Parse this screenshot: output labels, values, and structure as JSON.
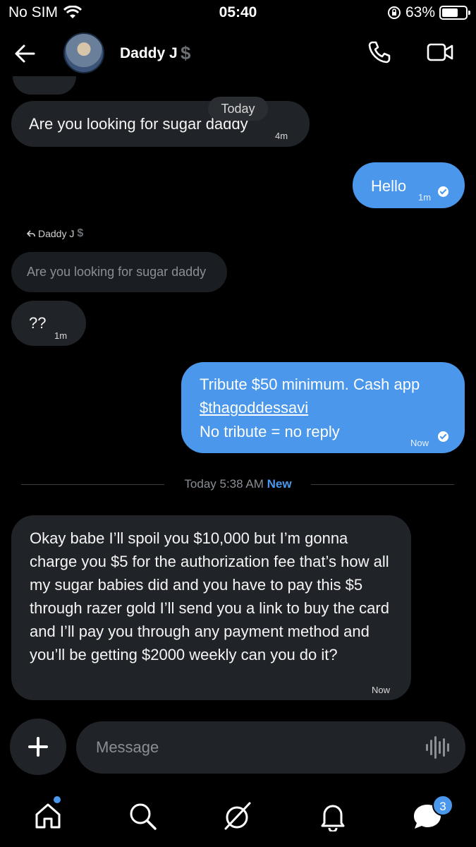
{
  "status_bar": {
    "carrier": "No SIM",
    "time": "05:40",
    "battery": "63%",
    "battery_level": 0.63
  },
  "header": {
    "contact_name": "Daddy J",
    "badge_symbol": "$",
    "back_icon": "back-arrow-icon",
    "call_icon": "phone-icon",
    "video_icon": "video-camera-icon"
  },
  "chat": {
    "date_pill": "Today",
    "messages": [
      {
        "direction": "incoming",
        "text": "Are you looking for sugar daddy",
        "time": "4m"
      },
      {
        "direction": "outgoing",
        "text": "Hello",
        "time": "1m",
        "read": true
      },
      {
        "direction": "incoming",
        "reply_to": "Daddy J",
        "reply_to_badge": "$",
        "quoted_text": "Are you looking for sugar daddy",
        "text": "??",
        "time": "1m"
      },
      {
        "direction": "outgoing",
        "text_line1": "Tribute $50 minimum. Cash app",
        "link": "$thagoddessavi",
        "text_line3": "No tribute = no reply",
        "time": "Now",
        "read": true
      },
      {
        "direction": "incoming",
        "text": "Okay babe I’ll spoil you $10,000 but I’m gonna charge you $5 for the authorization fee that’s how all my sugar babies did and you have to pay this $5 through razer gold I’ll send you a link to buy the card and I’ll pay you through any payment method and you’ll be getting $2000 weekly can you do it?",
        "time": "Now"
      }
    ],
    "divider": {
      "label": "Today 5:38 AM",
      "new_label": "New"
    }
  },
  "composer": {
    "placeholder": "Message",
    "add_icon": "plus-icon",
    "voice_icon": "voice-waveform-icon"
  },
  "tab_bar": {
    "items": [
      "home-icon",
      "search-icon",
      "grok-icon",
      "notifications-icon",
      "messages-icon"
    ],
    "messages_badge": "3",
    "accent": "#4a97eb"
  },
  "colors": {
    "outgoing_bubble": "#4a97eb",
    "incoming_bubble": "#202327",
    "background": "#000000"
  }
}
